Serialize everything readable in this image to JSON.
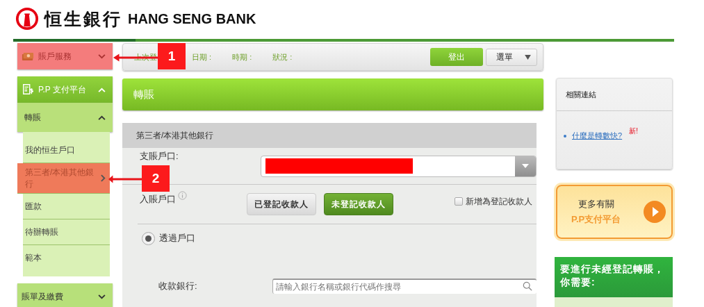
{
  "header": {
    "bank_name_chinese": "恒生銀行",
    "bank_name_english": "HANG SENG BANK"
  },
  "sidebar": {
    "sections": [
      {
        "label": "賬戶服務",
        "expanded": false,
        "highlighted": true
      },
      {
        "label": "P.P 支付平台",
        "expanded": true,
        "highlighted": false,
        "children": [
          {
            "label": "轉賬",
            "expanded": true,
            "children": [
              {
                "label": "我的恒生戶口",
                "selected": false
              },
              {
                "label": "第三者/本港其他銀行",
                "selected": true
              },
              {
                "label": "匯款",
                "selected": false
              },
              {
                "label": "待辦轉賬",
                "selected": false
              },
              {
                "label": "範本",
                "selected": false
              }
            ]
          }
        ]
      },
      {
        "label": "賬單及繳費",
        "expanded": false,
        "highlighted": false
      }
    ]
  },
  "info_bar": {
    "fields": [
      {
        "label": "上次登"
      },
      {
        "label": "日期 :"
      },
      {
        "label": "時期 :"
      },
      {
        "label": "狀況 :"
      }
    ],
    "logout_button": "登出",
    "menu_button": "選單"
  },
  "page_title": "轉賬",
  "form": {
    "tab": "第三者/本港其他銀行",
    "debit_account": {
      "label": "支賬戶口:",
      "redacted": true
    },
    "credit_account": {
      "label": "入賬戶口",
      "payee_buttons": [
        {
          "label": "已登記收款人",
          "selected": false
        },
        {
          "label": "未登記收款人",
          "selected": true
        }
      ],
      "add_payee": {
        "label": "新增為登記收款人",
        "checked": false
      }
    },
    "transfer_method": {
      "label": "透過戶口",
      "selected": true
    },
    "bank": {
      "label": "收款銀行:",
      "placeholder": "請輸入銀行名稱或銀行代碼作搜尋"
    }
  },
  "related_links": {
    "title": "相關連結",
    "links": [
      {
        "text": "什麼是轉數快?",
        "badge": "新!"
      }
    ]
  },
  "promo": {
    "line_1": "更多有關",
    "line_2": "P.P支付平台"
  },
  "requirements": {
    "title": "要進行未經登記轉賬，你需要:"
  },
  "annotations": [
    {
      "number": "1"
    },
    {
      "number": "2"
    }
  ]
}
